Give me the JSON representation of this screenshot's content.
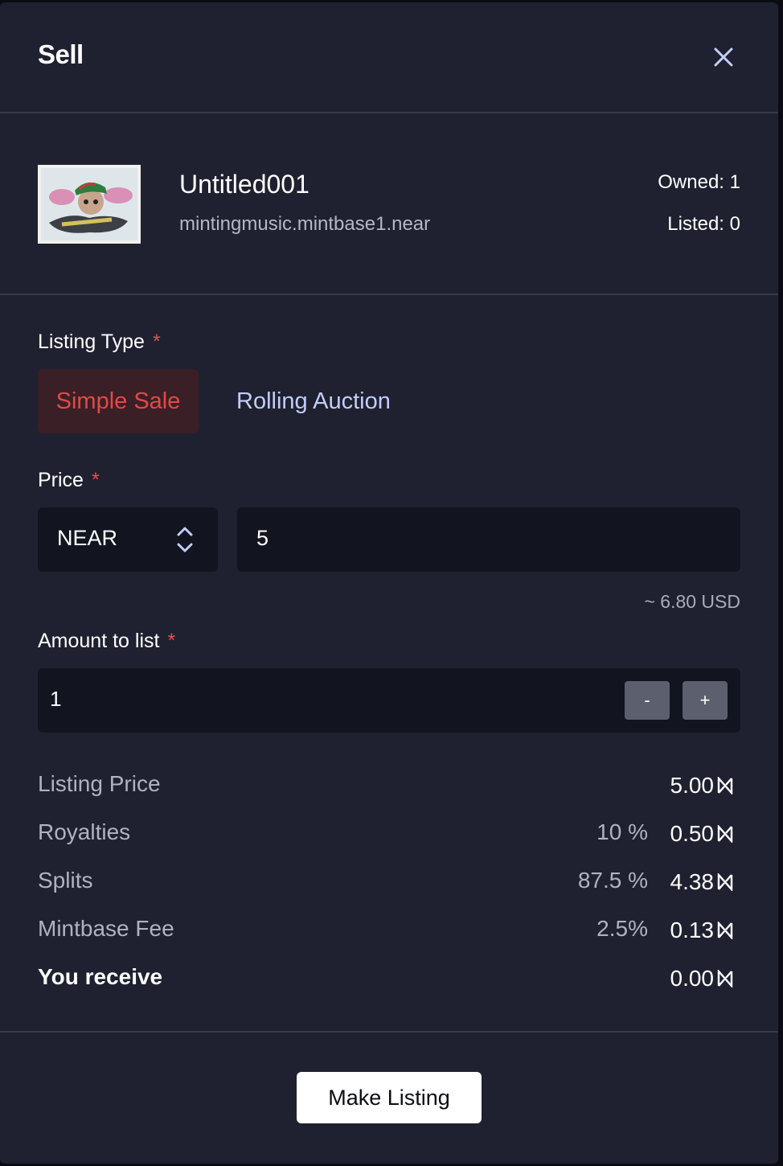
{
  "modal": {
    "title": "Sell"
  },
  "token": {
    "name": "Untitled001",
    "contract": "mintingmusic.mintbase1.near",
    "owned": "Owned: 1",
    "listed": "Listed: 0"
  },
  "listing_type": {
    "label": "Listing Type",
    "required": "*",
    "options": [
      "Simple Sale",
      "Rolling Auction"
    ],
    "selected": "Simple Sale"
  },
  "price": {
    "label": "Price",
    "required": "*",
    "currency": "NEAR",
    "value": "5",
    "usd_estimate": "~ 6.80 USD"
  },
  "amount": {
    "label": "Amount to list",
    "required": "*",
    "value": "1",
    "decrement": "-",
    "increment": "+"
  },
  "summary": {
    "listing_price": {
      "label": "Listing Price",
      "amount": "5.00"
    },
    "royalties": {
      "label": "Royalties",
      "percent": "10 %",
      "amount": "0.50"
    },
    "splits": {
      "label": "Splits",
      "percent": "87.5 %",
      "amount": "4.38"
    },
    "mintbase_fee": {
      "label": "Mintbase Fee",
      "percent": "2.5%",
      "amount": "0.13"
    },
    "you_receive": {
      "label": "You receive",
      "amount": "0.00"
    }
  },
  "actions": {
    "submit": "Make Listing"
  },
  "colors": {
    "background": "#1f2130",
    "accent_red": "#e24947",
    "link_blue": "#c3cdf6",
    "input_bg": "#121420"
  },
  "icons": [
    "close-icon",
    "nft-thumbnail",
    "select-updown-icon",
    "near-currency-icon"
  ]
}
